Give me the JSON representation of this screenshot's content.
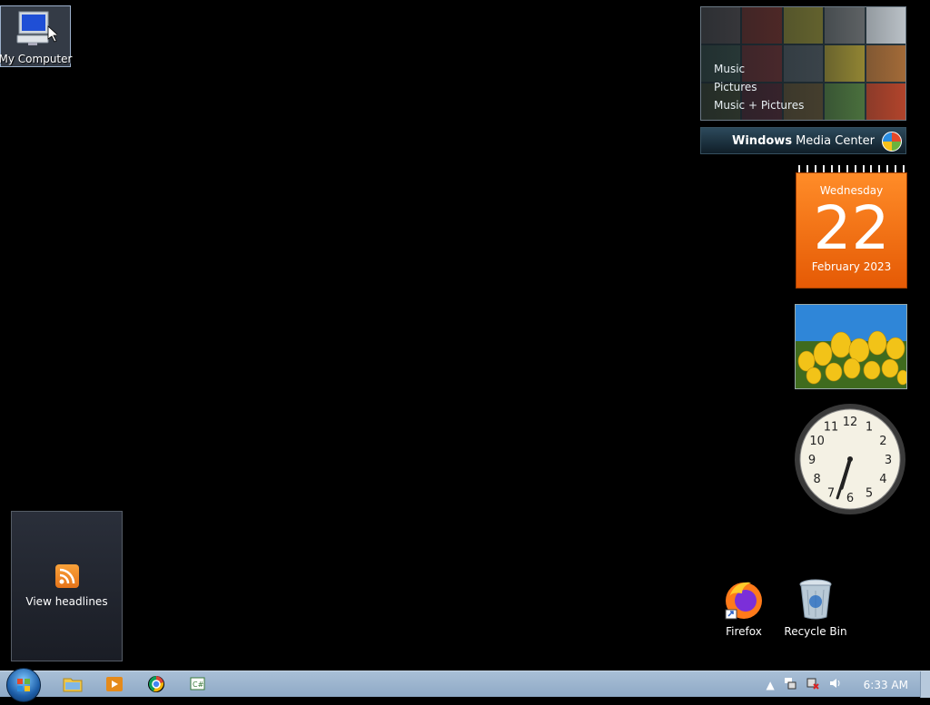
{
  "desktop": {
    "icons": {
      "my_computer": "My Computer",
      "firefox": "Firefox",
      "recycle_bin": "Recycle Bin"
    }
  },
  "gadgets": {
    "media_center": {
      "menu": [
        "Music",
        "Pictures",
        "Music + Pictures"
      ],
      "brand_bold": "Windows",
      "brand_rest": "Media Center"
    },
    "calendar": {
      "weekday": "Wednesday",
      "day": "22",
      "month_year": "February 2023"
    },
    "clock": {
      "hour": 6,
      "minute": 33
    },
    "feed": {
      "label": "View headlines"
    }
  },
  "taskbar": {
    "pinned": [
      "file-explorer-icon",
      "media-player-icon",
      "chrome-icon",
      "csharp-app-icon"
    ],
    "tray": {
      "time": "6:33 AM"
    }
  },
  "colors": {
    "calendar_orange": "#f07818",
    "taskbar": "#9fb6cf"
  }
}
